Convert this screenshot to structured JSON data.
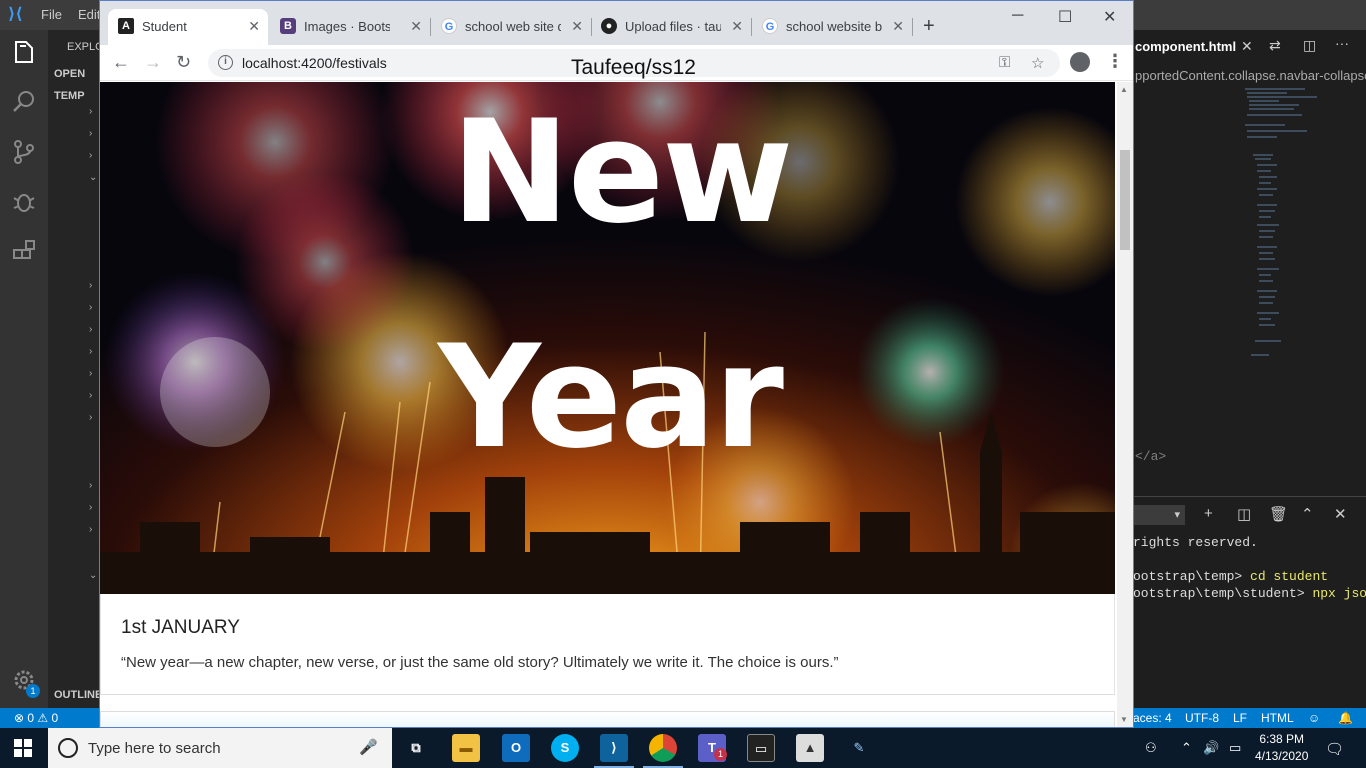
{
  "vscode": {
    "menu": [
      "File",
      "Edit"
    ],
    "sidebar": {
      "explorer_title": "EXPLORER",
      "open_editors": "OPEN",
      "workspace": "TEMP",
      "outline": "OUTLINE"
    },
    "editor_tab": "component.html",
    "breadcrumb": "pportedContent.collapse.navbar-collapse",
    "code_fragment": "</a>",
    "terminal": {
      "lines": [
        {
          "prefix": "rights reserved.",
          "cmd": ""
        },
        {
          "prefix": "ootstrap\\temp> ",
          "cmd": "cd student"
        },
        {
          "prefix": "ootstrap\\temp\\student> ",
          "cmd": "npx json"
        }
      ]
    },
    "statusbar": {
      "problems": "⊗ 0 ⚠ 0",
      "spaces": "aces: 4",
      "encoding": "UTF-8",
      "eol": "LF",
      "language": "HTML",
      "notifications_badge": "1"
    },
    "settings_badge": "1"
  },
  "chrome": {
    "tabs": [
      {
        "title": "Student",
        "icon": "angular-icon",
        "active": true
      },
      {
        "title": "Images · Bootstrap",
        "icon": "bootstrap-icon",
        "active": false
      },
      {
        "title": "school web site de",
        "icon": "google-icon",
        "active": false
      },
      {
        "title": "Upload files · taufe",
        "icon": "github-icon",
        "active": false
      },
      {
        "title": "school website ba",
        "icon": "google-icon",
        "active": false
      }
    ],
    "url": "localhost:4200/festivals",
    "overlay_title": "Taufeeq/ss12"
  },
  "page": {
    "hero": {
      "line1": "New",
      "line2": "Year"
    },
    "card_title": "1st JANUARY",
    "card_text": "“New year—a new chapter, new verse, or just the same old story? Ultimately we write it. The choice is ours.”"
  },
  "taskbar": {
    "search_placeholder": "Type here to search",
    "time": "6:38 PM",
    "date": "4/13/2020",
    "teams_badge": "1"
  },
  "colors": {
    "vscode_accent": "#007acc",
    "chrome_tabstrip": "#dee1e6",
    "taskbar": "#0b1a2a"
  }
}
